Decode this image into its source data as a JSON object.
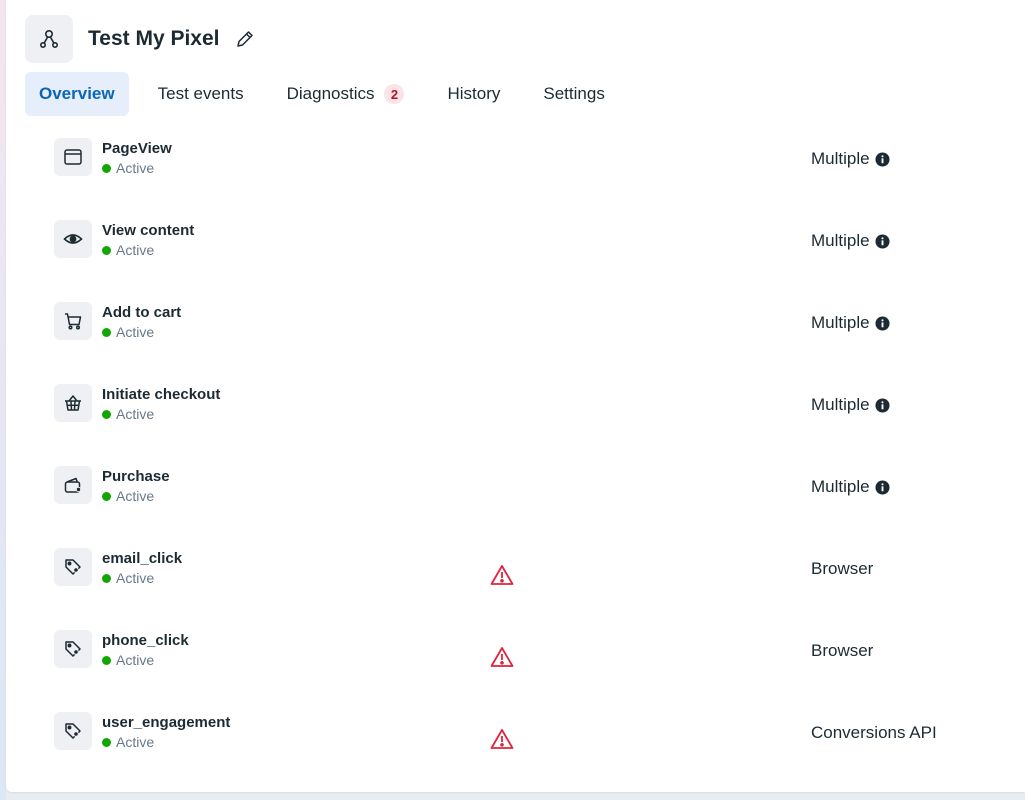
{
  "header": {
    "title": "Test My Pixel",
    "pixel_icon": "pixel-nodes-icon",
    "edit_icon": "pencil-icon"
  },
  "tabs": [
    {
      "label": "Overview",
      "active": true
    },
    {
      "label": "Test events"
    },
    {
      "label": "Diagnostics",
      "badge": "2"
    },
    {
      "label": "History"
    },
    {
      "label": "Settings"
    }
  ],
  "events": [
    {
      "name": "PageView",
      "status": "Active",
      "icon": "browser-window-icon",
      "source": "Multiple",
      "info": true,
      "warning": false
    },
    {
      "name": "View content",
      "status": "Active",
      "icon": "eye-icon",
      "source": "Multiple",
      "info": true,
      "warning": false
    },
    {
      "name": "Add to cart",
      "status": "Active",
      "icon": "cart-icon",
      "source": "Multiple",
      "info": true,
      "warning": false
    },
    {
      "name": "Initiate checkout",
      "status": "Active",
      "icon": "basket-icon",
      "source": "Multiple",
      "info": true,
      "warning": false
    },
    {
      "name": "Purchase",
      "status": "Active",
      "icon": "wallet-icon",
      "source": "Multiple",
      "info": true,
      "warning": false
    },
    {
      "name": "email_click",
      "status": "Active",
      "icon": "tag-icon",
      "source": "Browser",
      "info": false,
      "warning": true
    },
    {
      "name": "phone_click",
      "status": "Active",
      "icon": "tag-icon",
      "source": "Browser",
      "info": false,
      "warning": true
    },
    {
      "name": "user_engagement",
      "status": "Active",
      "icon": "tag-icon",
      "source": "Conversions API",
      "info": false,
      "warning": true
    }
  ],
  "colors": {
    "accent": "#0a66b7",
    "active_tab_bg": "#e5eefa",
    "status_active": "#12a600",
    "warning": "#e0233d",
    "badge_bg": "#fbe3e6",
    "badge_text": "#b0142b"
  }
}
